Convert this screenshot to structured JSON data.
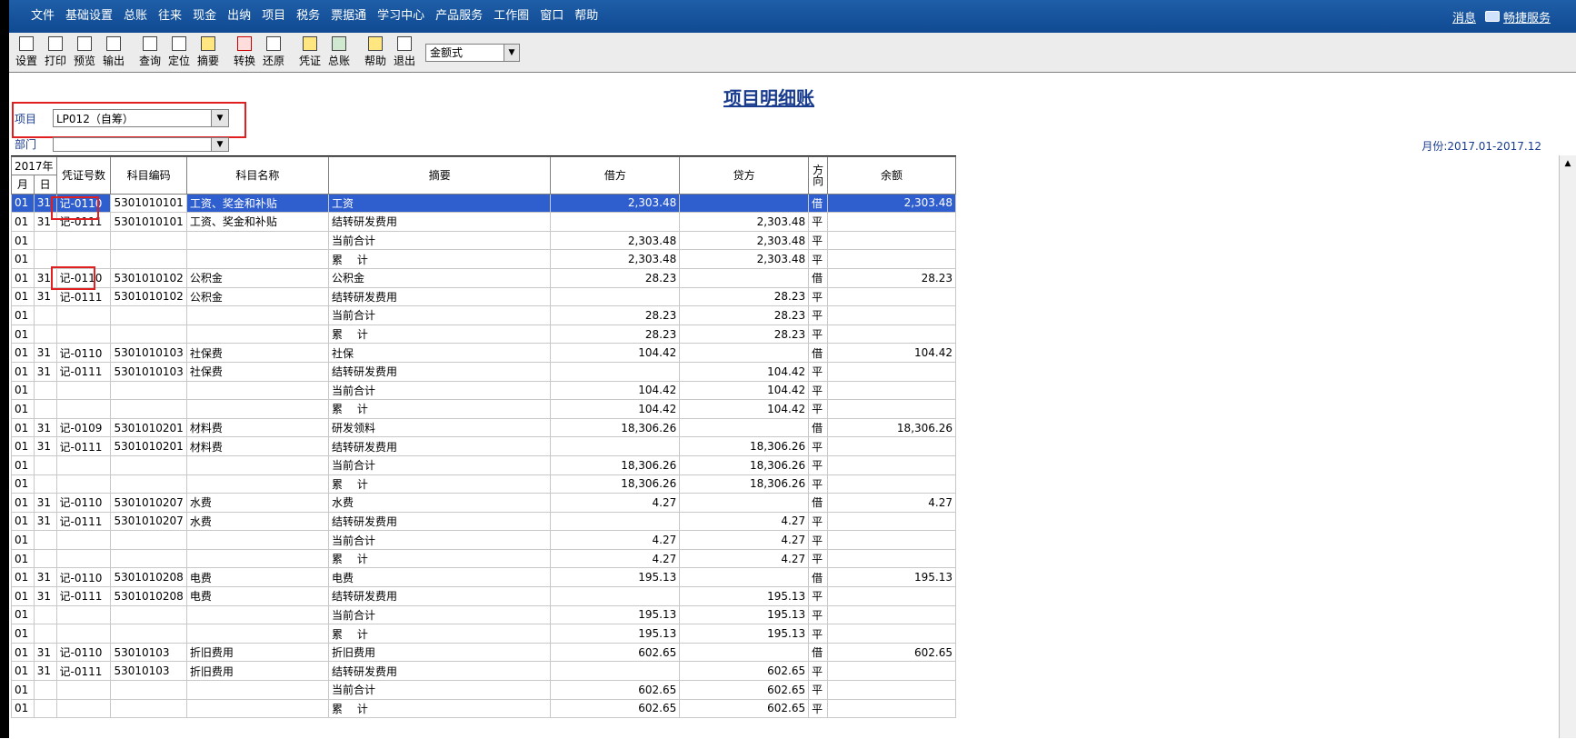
{
  "menubar": {
    "items": [
      "文件",
      "基础设置",
      "总账",
      "往来",
      "现金",
      "出纳",
      "项目",
      "税务",
      "票据通",
      "学习中心",
      "产品服务",
      "工作圈",
      "窗口",
      "帮助"
    ],
    "messages": "消息",
    "service": "畅捷服务"
  },
  "toolbar": {
    "buttons": [
      "设置",
      "打印",
      "预览",
      "输出",
      "查询",
      "定位",
      "摘要",
      "转换",
      "还原",
      "凭证",
      "总账",
      "帮助",
      "退出"
    ],
    "format_value": "金额式"
  },
  "report": {
    "title": "项目明细账",
    "project_label": "项目",
    "project_value": "LP012（自筹）",
    "dept_label": "部门",
    "dept_value": "",
    "period": "月份:2017.01-2017.12"
  },
  "table": {
    "year_header": "2017年",
    "headers": {
      "month": "月",
      "day": "日",
      "voucher": "凭证号数",
      "code": "科目编码",
      "name": "科目名称",
      "summary": "摘要",
      "debit": "借方",
      "credit": "贷方",
      "dir": "方向",
      "balance": "余额"
    },
    "rows": [
      [
        "01",
        "31",
        "记-0110",
        "5301010101",
        "工资、奖金和补贴",
        "工资",
        "2,303.48",
        "",
        "借",
        "2,303.48"
      ],
      [
        "01",
        "31",
        "记-0111",
        "5301010101",
        "工资、奖金和补贴",
        "结转研发费用",
        "",
        "2,303.48",
        "平",
        ""
      ],
      [
        "01",
        "",
        "",
        "",
        "",
        "当前合计",
        "2,303.48",
        "2,303.48",
        "平",
        ""
      ],
      [
        "01",
        "",
        "",
        "",
        "",
        "累　 计",
        "2,303.48",
        "2,303.48",
        "平",
        ""
      ],
      [
        "01",
        "31",
        "记-0110",
        "5301010102",
        "公积金",
        "公积金",
        "28.23",
        "",
        "借",
        "28.23"
      ],
      [
        "01",
        "31",
        "记-0111",
        "5301010102",
        "公积金",
        "结转研发费用",
        "",
        "28.23",
        "平",
        ""
      ],
      [
        "01",
        "",
        "",
        "",
        "",
        "当前合计",
        "28.23",
        "28.23",
        "平",
        ""
      ],
      [
        "01",
        "",
        "",
        "",
        "",
        "累　 计",
        "28.23",
        "28.23",
        "平",
        ""
      ],
      [
        "01",
        "31",
        "记-0110",
        "5301010103",
        "社保费",
        "社保",
        "104.42",
        "",
        "借",
        "104.42"
      ],
      [
        "01",
        "31",
        "记-0111",
        "5301010103",
        "社保费",
        "结转研发费用",
        "",
        "104.42",
        "平",
        ""
      ],
      [
        "01",
        "",
        "",
        "",
        "",
        "当前合计",
        "104.42",
        "104.42",
        "平",
        ""
      ],
      [
        "01",
        "",
        "",
        "",
        "",
        "累　 计",
        "104.42",
        "104.42",
        "平",
        ""
      ],
      [
        "01",
        "31",
        "记-0109",
        "5301010201",
        "材料费",
        "研发领料",
        "18,306.26",
        "",
        "借",
        "18,306.26"
      ],
      [
        "01",
        "31",
        "记-0111",
        "5301010201",
        "材料费",
        "结转研发费用",
        "",
        "18,306.26",
        "平",
        ""
      ],
      [
        "01",
        "",
        "",
        "",
        "",
        "当前合计",
        "18,306.26",
        "18,306.26",
        "平",
        ""
      ],
      [
        "01",
        "",
        "",
        "",
        "",
        "累　 计",
        "18,306.26",
        "18,306.26",
        "平",
        ""
      ],
      [
        "01",
        "31",
        "记-0110",
        "5301010207",
        "水费",
        "水费",
        "4.27",
        "",
        "借",
        "4.27"
      ],
      [
        "01",
        "31",
        "记-0111",
        "5301010207",
        "水费",
        "结转研发费用",
        "",
        "4.27",
        "平",
        ""
      ],
      [
        "01",
        "",
        "",
        "",
        "",
        "当前合计",
        "4.27",
        "4.27",
        "平",
        ""
      ],
      [
        "01",
        "",
        "",
        "",
        "",
        "累　 计",
        "4.27",
        "4.27",
        "平",
        ""
      ],
      [
        "01",
        "31",
        "记-0110",
        "5301010208",
        "电费",
        "电费",
        "195.13",
        "",
        "借",
        "195.13"
      ],
      [
        "01",
        "31",
        "记-0111",
        "5301010208",
        "电费",
        "结转研发费用",
        "",
        "195.13",
        "平",
        ""
      ],
      [
        "01",
        "",
        "",
        "",
        "",
        "当前合计",
        "195.13",
        "195.13",
        "平",
        ""
      ],
      [
        "01",
        "",
        "",
        "",
        "",
        "累　 计",
        "195.13",
        "195.13",
        "平",
        ""
      ],
      [
        "01",
        "31",
        "记-0110",
        "53010103",
        "折旧费用",
        "折旧费用",
        "602.65",
        "",
        "借",
        "602.65"
      ],
      [
        "01",
        "31",
        "记-0111",
        "53010103",
        "折旧费用",
        "结转研发费用",
        "",
        "602.65",
        "平",
        ""
      ],
      [
        "01",
        "",
        "",
        "",
        "",
        "当前合计",
        "602.65",
        "602.65",
        "平",
        ""
      ],
      [
        "01",
        "",
        "",
        "",
        "",
        "累　 计",
        "602.65",
        "602.65",
        "平",
        ""
      ]
    ]
  }
}
